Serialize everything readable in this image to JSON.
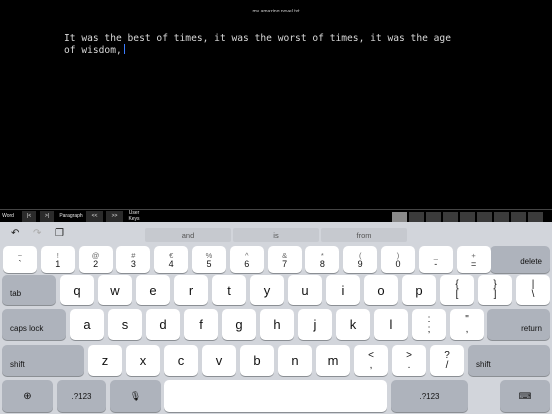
{
  "window": {
    "title": "my amazing novel.txt"
  },
  "editor": {
    "text": "It was the best of times, it was the worst of times, it was the age of wisdom,"
  },
  "toolbar": {
    "word": "Word",
    "prev_word": "|<",
    "next_word": ">|",
    "paragraph": "Paragraph",
    "prev_para": "<<",
    "next_para": ">>",
    "user_keys": "User Keys"
  },
  "suggestions": [
    "and",
    "is",
    "from"
  ],
  "icons": {
    "undo": "undo-icon",
    "redo": "redo-icon",
    "paste": "paste-icon",
    "globe": "globe-icon",
    "mic": "microphone-icon",
    "hide": "hide-keyboard-icon"
  },
  "keys": {
    "row0": [
      {
        "top": "~",
        "bot": "`"
      },
      {
        "top": "!",
        "bot": "1"
      },
      {
        "top": "@",
        "bot": "2"
      },
      {
        "top": "#",
        "bot": "3"
      },
      {
        "top": "€",
        "bot": "4"
      },
      {
        "top": "%",
        "bot": "5"
      },
      {
        "top": "^",
        "bot": "6"
      },
      {
        "top": "&",
        "bot": "7"
      },
      {
        "top": "*",
        "bot": "8"
      },
      {
        "top": "(",
        "bot": "9"
      },
      {
        "top": ")",
        "bot": "0"
      },
      {
        "top": "_",
        "bot": "-"
      },
      {
        "top": "+",
        "bot": "="
      }
    ],
    "delete": "delete",
    "tab": "tab",
    "row1": [
      "q",
      "w",
      "e",
      "r",
      "t",
      "y",
      "u",
      "i",
      "o",
      "p"
    ],
    "row1_extra": [
      {
        "top": "{",
        "bot": "["
      },
      {
        "top": "}",
        "bot": "]"
      },
      {
        "top": "|",
        "bot": "\\"
      }
    ],
    "caps": "caps lock",
    "row2": [
      "a",
      "s",
      "d",
      "f",
      "g",
      "h",
      "j",
      "k",
      "l"
    ],
    "row2_extra": [
      {
        "top": ":",
        "bot": ";"
      },
      {
        "top": "\"",
        "bot": ","
      }
    ],
    "return": "return",
    "shift_left": "shift",
    "row3": [
      "z",
      "x",
      "c",
      "v",
      "b",
      "n",
      "m"
    ],
    "row3_extra": [
      {
        "top": "<",
        "bot": ","
      },
      {
        "top": ">",
        "bot": "."
      },
      {
        "top": "?",
        "bot": "/"
      }
    ],
    "shift_right": "shift",
    "num_left": ".?123",
    "num_right": ".?123"
  }
}
